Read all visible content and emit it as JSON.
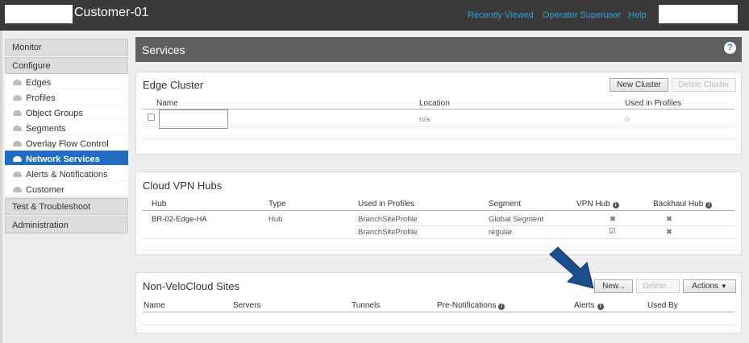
{
  "header": {
    "title": "Customer-01",
    "links": [
      "Recently Viewed",
      "Operator Superuser",
      "Help"
    ]
  },
  "sidebar": {
    "monitor": "Monitor",
    "configure": "Configure",
    "items": [
      {
        "label": "Edges",
        "icon": "cloud-icon"
      },
      {
        "label": "Profiles",
        "icon": "cloud-icon"
      },
      {
        "label": "Object Groups",
        "icon": "cloud-icon"
      },
      {
        "label": "Segments",
        "icon": "cloud-icon"
      },
      {
        "label": "Overlay Flow Control",
        "icon": "cloud-icon"
      },
      {
        "label": "Network Services",
        "icon": "cloud-icon",
        "active": true
      },
      {
        "label": "Alerts & Notifications",
        "icon": "cloud-icon"
      },
      {
        "label": "Customer",
        "icon": "cloud-icon"
      }
    ],
    "test": "Test & Troubleshoot",
    "admin": "Administration"
  },
  "services": {
    "title": "Services",
    "help": "?"
  },
  "edge_cluster": {
    "title": "Edge Cluster",
    "new_button": "New Cluster",
    "delete_button": "Delete Cluster",
    "columns": [
      "Name",
      "Location",
      "Used in Profiles"
    ],
    "rows": [
      {
        "location": "n/a",
        "used": "0"
      }
    ]
  },
  "vpn_hubs": {
    "title": "Cloud VPN Hubs",
    "columns": [
      "Hub",
      "Type",
      "Used in Profiles",
      "Segment",
      "VPN Hub",
      "Backhaul Hub"
    ],
    "rows": [
      {
        "hub": "BR-02-Edge-HA",
        "type": "Hub",
        "profile": "BranchSiteProfile",
        "segment": "Global Segment",
        "vpn": "✖",
        "backhaul": "✖"
      },
      {
        "hub": "",
        "type": "",
        "profile": "BranchSiteProfile",
        "segment": "regular",
        "vpn": "☑",
        "backhaul": "✖"
      }
    ]
  },
  "nvs": {
    "title": "Non-VeloCloud Sites",
    "new_button": "New...",
    "delete_button": "Delete...",
    "actions_button": "Actions",
    "columns": [
      "Name",
      "Servers",
      "Tunnels",
      "Pre-Notifications",
      "Alerts",
      "Used By"
    ]
  },
  "colors": {
    "accent": "#1f6dc2",
    "topbar": "#3a3a3a",
    "link": "#2f9fd8",
    "arrow": "#1a4f8c"
  }
}
